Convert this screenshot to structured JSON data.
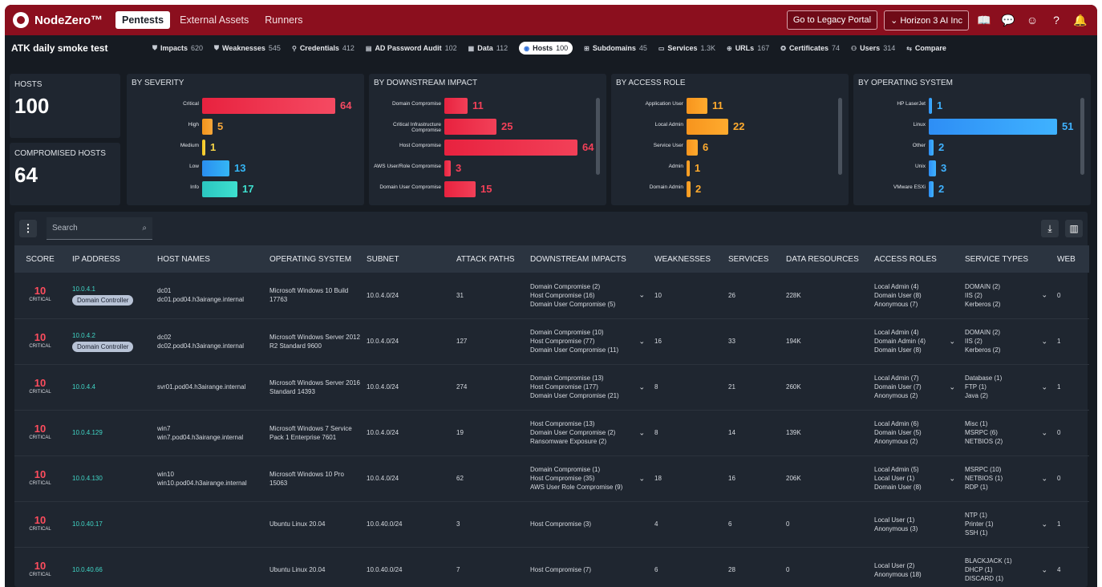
{
  "app": {
    "brand": "NodeZero™",
    "nav": [
      "Pentests",
      "External Assets",
      "Runners"
    ],
    "legacy_button": "Go to Legacy Portal",
    "org_button": "Horizon 3 AI Inc"
  },
  "scan": {
    "title": "ATK daily smoke test",
    "tabs": [
      {
        "label": "Impacts",
        "count": "620"
      },
      {
        "label": "Weaknesses",
        "count": "545"
      },
      {
        "label": "Credentials",
        "count": "412"
      },
      {
        "label": "AD Password Audit",
        "count": "102"
      },
      {
        "label": "Data",
        "count": "112"
      },
      {
        "label": "Hosts",
        "count": "100"
      },
      {
        "label": "Subdomains",
        "count": "45"
      },
      {
        "label": "Services",
        "count": "1.3K"
      },
      {
        "label": "URLs",
        "count": "167"
      },
      {
        "label": "Certificates",
        "count": "74"
      },
      {
        "label": "Users",
        "count": "314"
      },
      {
        "label": "Compare",
        "count": ""
      }
    ]
  },
  "stats": {
    "hosts_label": "HOSTS",
    "hosts_value": "100",
    "compromised_label": "COMPROMISED HOSTS",
    "compromised_value": "64"
  },
  "colors": {
    "critical": "#e8223f",
    "high": "#f2931b",
    "medium": "#f5c518",
    "low": "#2a8ef0",
    "info": "#2bc6c0",
    "impact": "#e8223f",
    "access": "#f7941d",
    "os": "#2e8ef5"
  },
  "chart_data": [
    {
      "type": "bar",
      "title": "BY SEVERITY",
      "categories": [
        "Critical",
        "High",
        "Medium",
        "Low",
        "Info"
      ],
      "values": [
        64,
        5,
        1,
        13,
        17
      ]
    },
    {
      "type": "bar",
      "title": "BY DOWNSTREAM IMPACT",
      "categories": [
        "Domain Compromise",
        "Critical Infrastructure Compromise",
        "Host Compromise",
        "AWS User/Role Compromise",
        "Domain User Compromise"
      ],
      "values": [
        11,
        25,
        64,
        3,
        15
      ]
    },
    {
      "type": "bar",
      "title": "BY ACCESS ROLE",
      "categories": [
        "Application User",
        "Local Admin",
        "Service User",
        "Admin",
        "Domain Admin"
      ],
      "values": [
        11,
        22,
        6,
        1,
        2
      ]
    },
    {
      "type": "bar",
      "title": "BY OPERATING SYSTEM",
      "categories": [
        "HP LaserJet",
        "Linux",
        "Other",
        "Unix",
        "VMware ESXi"
      ],
      "values": [
        1,
        51,
        2,
        3,
        2
      ]
    }
  ],
  "table": {
    "search_placeholder": "Search",
    "columns": [
      "SCORE",
      "IP ADDRESS",
      "HOST NAMES",
      "OPERATING SYSTEM",
      "SUBNET",
      "ATTACK PATHS",
      "DOWNSTREAM IMPACTS",
      "WEAKNESSES",
      "SERVICES",
      "DATA RESOURCES",
      "ACCESS ROLES",
      "SERVICE TYPES",
      "WEB"
    ],
    "rows": [
      {
        "score": "10",
        "severity": "CRITICAL",
        "ip": "10.0.4.1",
        "badge": "Domain Controller",
        "hosts": [
          "dc01",
          "dc01.pod04.h3airange.internal"
        ],
        "os": "Microsoft Windows 10 Build 17763",
        "subnet": "10.0.4.0/24",
        "paths": "31",
        "impacts": [
          "Domain Compromise (2)",
          "Host Compromise (16)",
          "Domain User Compromise (5)"
        ],
        "weak": "10",
        "services": "26",
        "data": "228K",
        "roles": [
          "Local Admin (4)",
          "Domain User (8)",
          "Anonymous (7)"
        ],
        "roles_more": false,
        "types": [
          "DOMAIN (2)",
          "IIS (2)",
          "Kerberos (2)"
        ],
        "web": "0"
      },
      {
        "score": "10",
        "severity": "CRITICAL",
        "ip": "10.0.4.2",
        "badge": "Domain Controller",
        "hosts": [
          "dc02",
          "dc02.pod04.h3airange.internal"
        ],
        "os": "Microsoft Windows Server 2012 R2 Standard 9600",
        "subnet": "10.0.4.0/24",
        "paths": "127",
        "impacts": [
          "Domain Compromise (10)",
          "Host Compromise (77)",
          "Domain User Compromise (11)"
        ],
        "weak": "16",
        "services": "33",
        "data": "194K",
        "roles": [
          "Local Admin (4)",
          "Domain Admin (4)",
          "Domain User (8)"
        ],
        "roles_more": true,
        "types": [
          "DOMAIN (2)",
          "IIS (2)",
          "Kerberos (2)"
        ],
        "web": "1"
      },
      {
        "score": "10",
        "severity": "CRITICAL",
        "ip": "10.0.4.4",
        "badge": "",
        "hosts": [
          "svr01.pod04.h3airange.internal"
        ],
        "os": "Microsoft Windows Server 2016 Standard 14393",
        "subnet": "10.0.4.0/24",
        "paths": "274",
        "impacts": [
          "Domain Compromise (13)",
          "Host Compromise (177)",
          "Domain User Compromise (21)"
        ],
        "weak": "8",
        "services": "21",
        "data": "260K",
        "roles": [
          "Local Admin (7)",
          "Domain User (7)",
          "Anonymous (2)"
        ],
        "roles_more": true,
        "types": [
          "Database (1)",
          "FTP (1)",
          "Java (2)"
        ],
        "web": "1"
      },
      {
        "score": "10",
        "severity": "CRITICAL",
        "ip": "10.0.4.129",
        "badge": "",
        "hosts": [
          "win7",
          "win7.pod04.h3airange.internal"
        ],
        "os": "Microsoft Windows 7 Service Pack 1 Enterprise 7601",
        "subnet": "10.0.4.0/24",
        "paths": "19",
        "impacts": [
          "Host Compromise (13)",
          "Domain User Compromise (2)",
          "Ransomware Exposure (2)"
        ],
        "weak": "8",
        "services": "14",
        "data": "139K",
        "roles": [
          "Local Admin (6)",
          "Domain User (5)",
          "Anonymous (2)"
        ],
        "roles_more": false,
        "types": [
          "Misc (1)",
          "MSRPC (6)",
          "NETBIOS (2)"
        ],
        "web": "0"
      },
      {
        "score": "10",
        "severity": "CRITICAL",
        "ip": "10.0.4.130",
        "badge": "",
        "hosts": [
          "win10",
          "win10.pod04.h3airange.internal"
        ],
        "os": "Microsoft Windows 10 Pro 15063",
        "subnet": "10.0.4.0/24",
        "paths": "62",
        "impacts": [
          "Domain Compromise (1)",
          "Host Compromise (35)",
          "AWS User Role Compromise (9)"
        ],
        "weak": "18",
        "services": "16",
        "data": "206K",
        "roles": [
          "Local Admin (5)",
          "Local User (1)",
          "Domain User (8)"
        ],
        "roles_more": true,
        "types": [
          "MSRPC (10)",
          "NETBIOS (1)",
          "RDP (1)"
        ],
        "web": "0"
      },
      {
        "score": "10",
        "severity": "CRITICAL",
        "ip": "10.0.40.17",
        "badge": "",
        "hosts": [],
        "os": "Ubuntu Linux 20.04",
        "subnet": "10.0.40.0/24",
        "paths": "3",
        "impacts": [
          "Host Compromise (3)"
        ],
        "weak": "4",
        "services": "6",
        "data": "0",
        "roles": [
          "Local User (1)",
          "Anonymous (3)"
        ],
        "roles_more": false,
        "types": [
          "NTP (1)",
          "Printer (1)",
          "SSH (1)"
        ],
        "web": "1"
      },
      {
        "score": "10",
        "severity": "CRITICAL",
        "ip": "10.0.40.66",
        "badge": "",
        "hosts": [],
        "os": "Ubuntu Linux 20.04",
        "subnet": "10.0.40.0/24",
        "paths": "7",
        "impacts": [
          "Host Compromise (7)"
        ],
        "weak": "6",
        "services": "28",
        "data": "0",
        "roles": [
          "Local User (2)",
          "Anonymous (18)"
        ],
        "roles_more": false,
        "types": [
          "BLACKJACK (1)",
          "DHCP (1)",
          "DISCARD (1)"
        ],
        "web": "4"
      }
    ]
  }
}
